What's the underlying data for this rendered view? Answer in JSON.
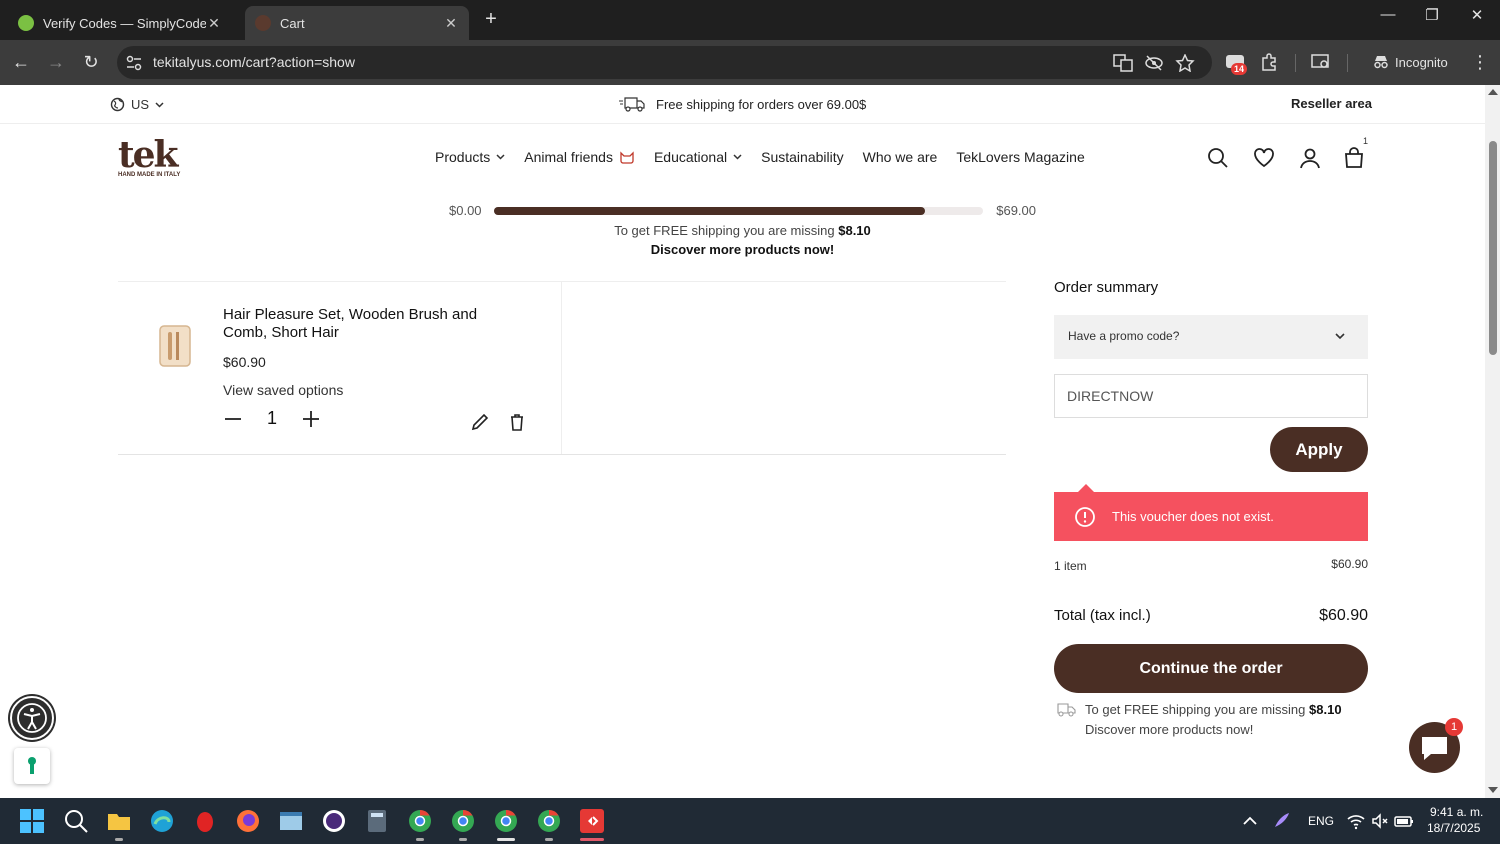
{
  "browser": {
    "tabs": [
      {
        "title": "Verify Codes — SimplyCodes",
        "active": false
      },
      {
        "title": "Cart",
        "active": true
      }
    ],
    "url": "tekitalyus.com/cart?action=show",
    "extensions_badge": "14",
    "profile_label": "Incognito"
  },
  "site": {
    "locale": "US",
    "shipping_notice": "Free shipping for orders over 69.00$",
    "reseller_link": "Reseller area",
    "logo_text": "tek",
    "logo_tagline": "HAND MADE IN ITALY",
    "nav": [
      {
        "label": "Products"
      },
      {
        "label": "Animal friends"
      },
      {
        "label": "Educational"
      },
      {
        "label": "Sustainability"
      },
      {
        "label": "Who we are"
      },
      {
        "label": "TekLovers Magazine"
      }
    ],
    "cart_count": "1"
  },
  "shipping_progress": {
    "min_label": "$0.00",
    "max_label": "$69.00",
    "fraction": 0.882,
    "missing_prefix": "To get FREE shipping you are missing",
    "missing_amount": "$8.10",
    "discover": "Discover more products now!"
  },
  "cart": {
    "items": [
      {
        "name": "Hair Pleasure Set, Wooden Brush and Comb, Short Hair",
        "price": "$60.90",
        "saved_options": "View saved options",
        "quantity": "1"
      }
    ]
  },
  "summary": {
    "title": "Order summary",
    "promo_toggle": "Have a promo code?",
    "promo_value": "DIRECTNOW",
    "apply_label": "Apply",
    "error": "This voucher does not exist.",
    "items_label": "1 item",
    "items_value": "$60.90",
    "total_label": "Total (tax incl.)",
    "total_value": "$60.90",
    "continue_label": "Continue the order",
    "ship_prefix": "To get FREE shipping you are missing",
    "ship_amount": "$8.10",
    "ship_discover": "Discover more products now!"
  },
  "chat_badge": "1",
  "taskbar": {
    "lang": "ENG",
    "time": "9:41 a. m.",
    "date": "18/7/2025"
  },
  "colors": {
    "brand_brown": "#4a2e24",
    "error_red": "#f5515f"
  }
}
